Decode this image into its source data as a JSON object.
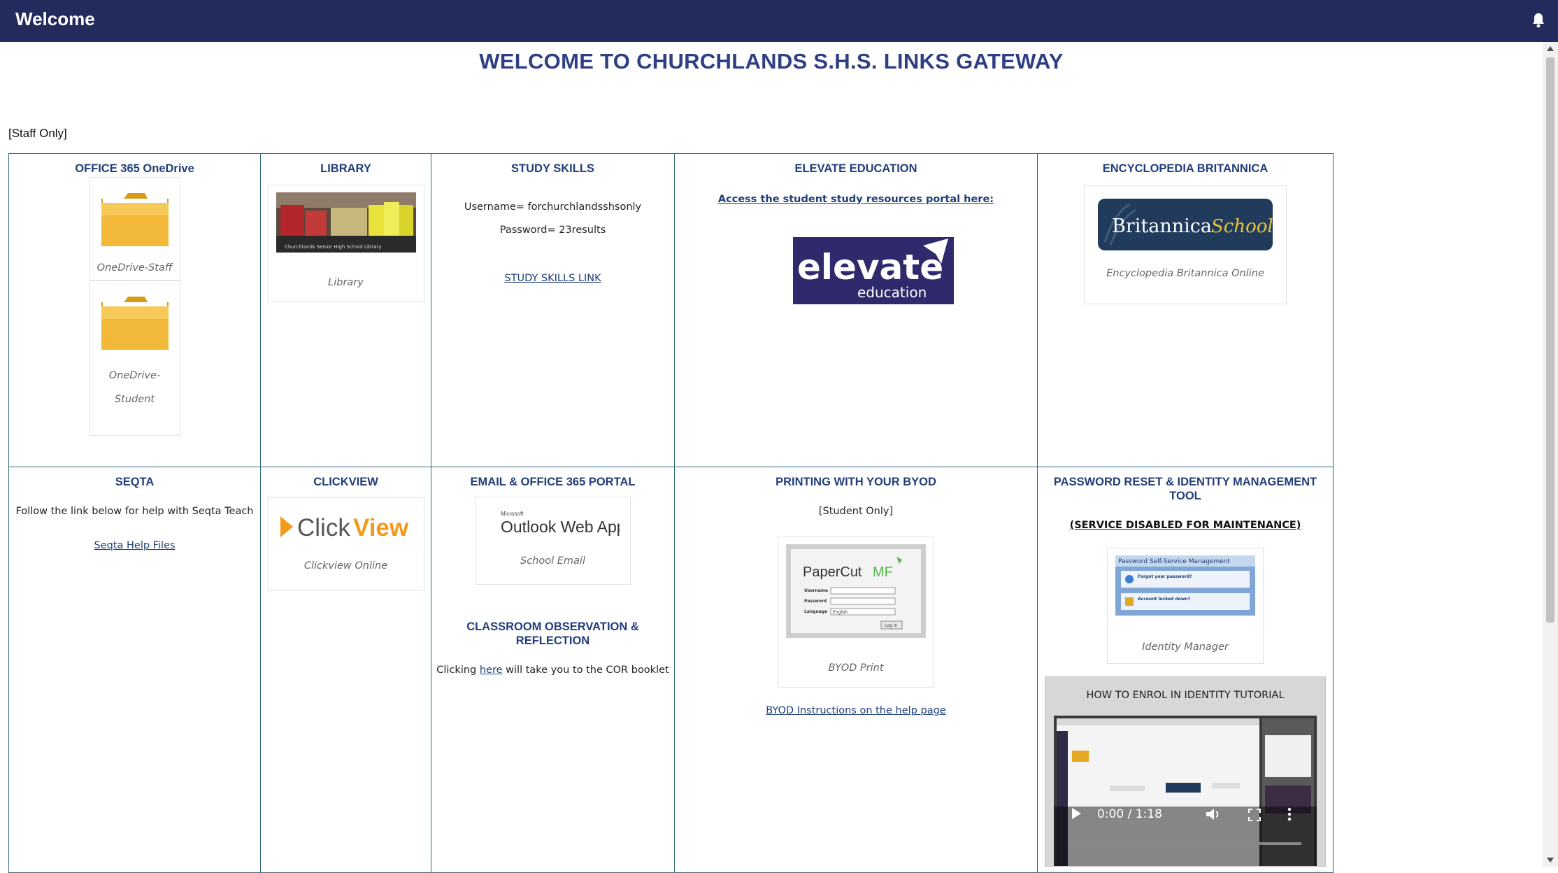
{
  "header": {
    "title": "Welcome",
    "bell_icon": "bell-icon"
  },
  "page": {
    "title": "WELCOME TO CHURCHLANDS S.H.S. LINKS GATEWAY",
    "staff_note": "[Staff Only]"
  },
  "tiles": {
    "onedrive": {
      "heading": "OFFICE 365 OneDrive",
      "staff_caption": "OneDrive-Staff",
      "student_caption_1": "OneDrive-",
      "student_caption_2": "Student"
    },
    "library": {
      "heading": "LIBRARY",
      "caption": "Library",
      "image_text": "Churchlands Senior High School Library"
    },
    "study_skills": {
      "heading": "STUDY SKILLS",
      "username": "Username= forchurchlandsshsonly",
      "password": "Password= 23results",
      "link": "STUDY SKILLS LINK"
    },
    "elevate": {
      "heading": "ELEVATE EDUCATION",
      "link": "Access the student study resources portal here:",
      "logo_main": "elevate",
      "logo_sub": "education"
    },
    "britannica": {
      "heading": "ENCYCLOPEDIA BRITANNICA",
      "logo_main": "Britannica",
      "logo_sub": "School",
      "caption": "Encyclopedia Britannica Online"
    },
    "seqta": {
      "heading": "SEQTA",
      "text": "Follow the link below for help with Seqta Teach",
      "link": "Seqta Help Files"
    },
    "clickview": {
      "heading": "CLICKVIEW",
      "logo_a": "Click",
      "logo_b": "View",
      "caption": "Clickview Online"
    },
    "email": {
      "heading": "EMAIL & OFFICE 365 PORTAL",
      "logo_small": "Microsoft",
      "logo_main": "Outlook Web App",
      "caption": "School Email",
      "cor_heading_1": "CLASSROOM OBSERVATION &",
      "cor_heading_2": "REFLECTION",
      "cor_text_before": "Clicking ",
      "cor_link": "here",
      "cor_text_after": " will take you to the COR booklet"
    },
    "printing": {
      "heading": "PRINTING WITH YOUR BYOD",
      "note": "[Student Only]",
      "logo_main": "PaperCut",
      "logo_mf": "MF",
      "form_username": "Username",
      "form_password": "Password",
      "form_language": "Language",
      "form_language_value": "English",
      "form_button": "Log In",
      "caption": "BYOD Print",
      "link": "BYOD Instructions on the help page"
    },
    "password": {
      "heading_1": "PASSWORD RESET & IDENTITY MANAGEMENT",
      "heading_2": "TOOL",
      "notice": "(SERVICE DISABLED FOR MAINTENANCE)",
      "panel_title": "Password Self-Service Management",
      "item_1": "Forgot your password?",
      "item_2": "Account locked down?",
      "caption": "Identity Manager",
      "video_title": "HOW TO ENROL IN IDENTITY TUTORIAL",
      "video_time": "0:00 / 1:18"
    }
  },
  "colors": {
    "header_bg": "#222b5c",
    "title": "#2e3f85",
    "heading": "#223d7a",
    "grid_border": "#2f6a78",
    "elevate_bg": "#2e2a6c",
    "britannica_bg": "#203b5c"
  }
}
